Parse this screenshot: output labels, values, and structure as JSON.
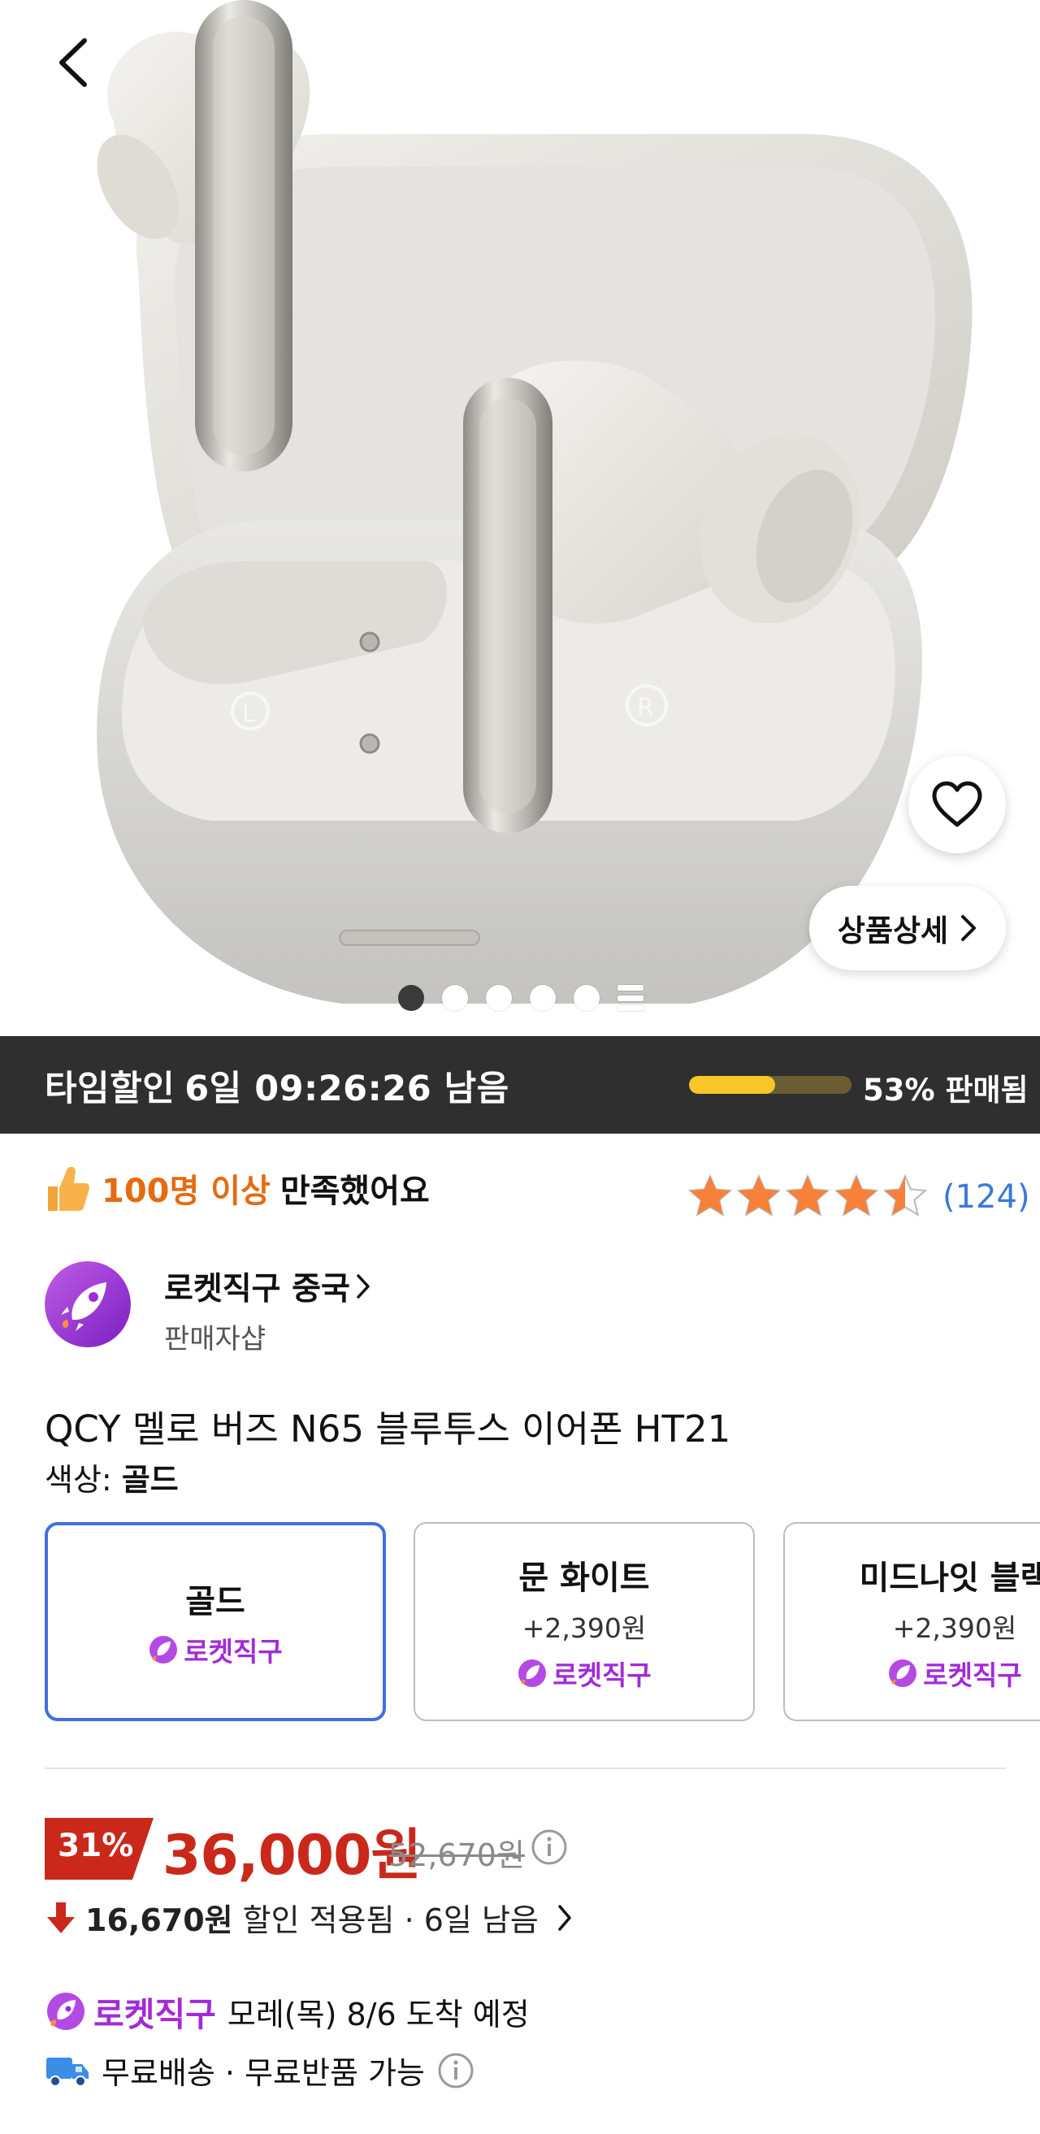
{
  "gallery": {
    "total_dots": 5,
    "active_index": 0
  },
  "timesale": {
    "label": "타임할인",
    "remaining": "6일 09:26:26 남음",
    "sold_percent": 53,
    "sold_label": "53% 판매됨"
  },
  "hero_buttons": {
    "detail_label": "상품상세"
  },
  "rating": {
    "satisfied_prefix": "100명 이상",
    "satisfied_suffix": "만족했어요",
    "stars": 4.5,
    "review_count": "(124)"
  },
  "seller": {
    "name": "로켓직구 중국",
    "subtitle": "판매자샵"
  },
  "product": {
    "title": "QCY 멜로 버즈 N65 블루투스 이어폰 HT21",
    "color_label": "색상:",
    "color_value": "골드"
  },
  "options": [
    {
      "name": "골드",
      "price": "",
      "badge": "로켓직구",
      "selected": true
    },
    {
      "name": "문 화이트",
      "price": "+2,390원",
      "badge": "로켓직구",
      "selected": false
    },
    {
      "name": "미드나잇 블랙",
      "price": "+2,390원",
      "badge": "로켓직구",
      "selected": false
    }
  ],
  "price": {
    "discount": "31%",
    "sale": "36,000원",
    "original": "52,670원",
    "saving_amount": "16,670원",
    "saving_text": "할인 적용됨 · 6일 남음"
  },
  "delivery": {
    "badge": "로켓직구",
    "eta": "모레(목) 8/6 도착 예정",
    "shipping": "무료배송 · 무료반품 가능"
  },
  "colors": {
    "accent_red": "#c9281b",
    "rocket_purple": "#a32ad9",
    "select_blue": "#3f6fe0",
    "star": "#f7813a",
    "review_blue": "#3a79d8"
  }
}
